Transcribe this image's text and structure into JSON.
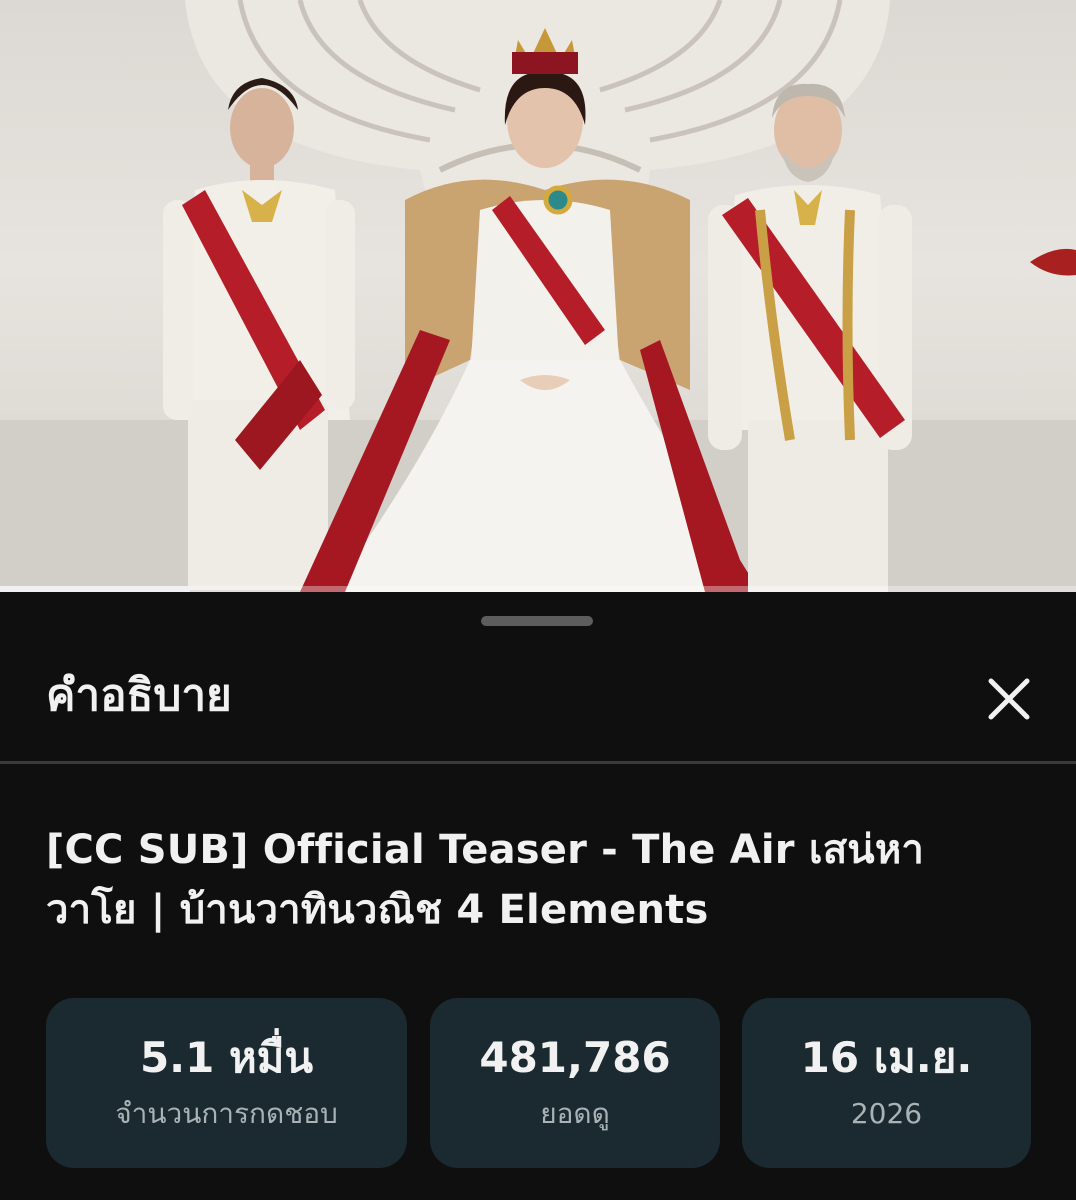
{
  "video": {
    "progress_fraction": 0.177
  },
  "sheet": {
    "title": "คำอธิบาย",
    "close_icon": "close-icon"
  },
  "description": {
    "video_title": "[CC SUB] Official Teaser - The Air เสน่หาวาโย | บ้านวาทินวณิช 4 Elements"
  },
  "stats": [
    {
      "value": "5.1 หมื่น",
      "label": "จำนวนการกดชอบ"
    },
    {
      "value": "481,786",
      "label": "ยอดดู"
    },
    {
      "value": "16 เม.ย.",
      "label": "2026"
    }
  ],
  "colors": {
    "sheet_background": "#0f0f0f",
    "stat_card": "#1b2a30",
    "sash_red": "#b51e28"
  }
}
